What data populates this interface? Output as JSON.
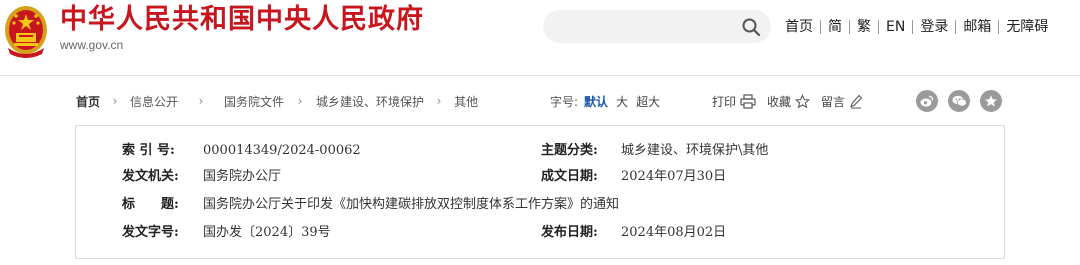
{
  "header": {
    "site_title": "中华人民共和国中央人民政府",
    "site_domain": "www.gov.cn",
    "emblem_icon": "national-emblem-icon",
    "search": {
      "placeholder": "",
      "icon": "search-icon"
    },
    "nav": [
      {
        "label": "首页"
      },
      {
        "label": "简"
      },
      {
        "label": "繁"
      },
      {
        "label": "EN"
      },
      {
        "label": "登录"
      },
      {
        "label": "邮箱"
      },
      {
        "label": "无障碍"
      }
    ]
  },
  "breadcrumb": {
    "home": "首页",
    "items": [
      "信息公开",
      "国务院文件",
      "城乡建设、环境保护",
      "其他"
    ],
    "separator": "›"
  },
  "font_size": {
    "label": "字号:",
    "options": [
      {
        "label": "默认",
        "active": true
      },
      {
        "label": "大",
        "active": false
      },
      {
        "label": "超大",
        "active": false
      }
    ]
  },
  "tools": {
    "print": {
      "label": "打印",
      "icon": "printer-icon"
    },
    "favorite": {
      "label": "收藏",
      "icon": "star-outline-icon"
    },
    "comment": {
      "label": "留言",
      "icon": "pencil-icon"
    }
  },
  "share": [
    {
      "icon": "weibo-icon"
    },
    {
      "icon": "wechat-icon"
    },
    {
      "icon": "favorite-star-icon"
    }
  ],
  "info": {
    "index_label": "索 引 号:",
    "index_value": "000014349/2024-00062",
    "category_label": "主题分类:",
    "category_value": "城乡建设、环境保护\\其他",
    "issuer_label": "发文机关:",
    "issuer_value": "国务院办公厅",
    "written_date_label": "成文日期:",
    "written_date_value": "2024年07月30日",
    "title_label": "标　　题:",
    "title_value": "国务院办公厅关于印发《加快构建碳排放双控制度体系工作方案》的通知",
    "doc_no_label": "发文字号:",
    "doc_no_value": "国办发〔2024〕39号",
    "publish_date_label": "发布日期:",
    "publish_date_value": "2024年08月02日"
  },
  "colors": {
    "brand_red": "#c8161e",
    "active_blue": "#1c5aa6",
    "share_gray": "#9a9a9a"
  }
}
